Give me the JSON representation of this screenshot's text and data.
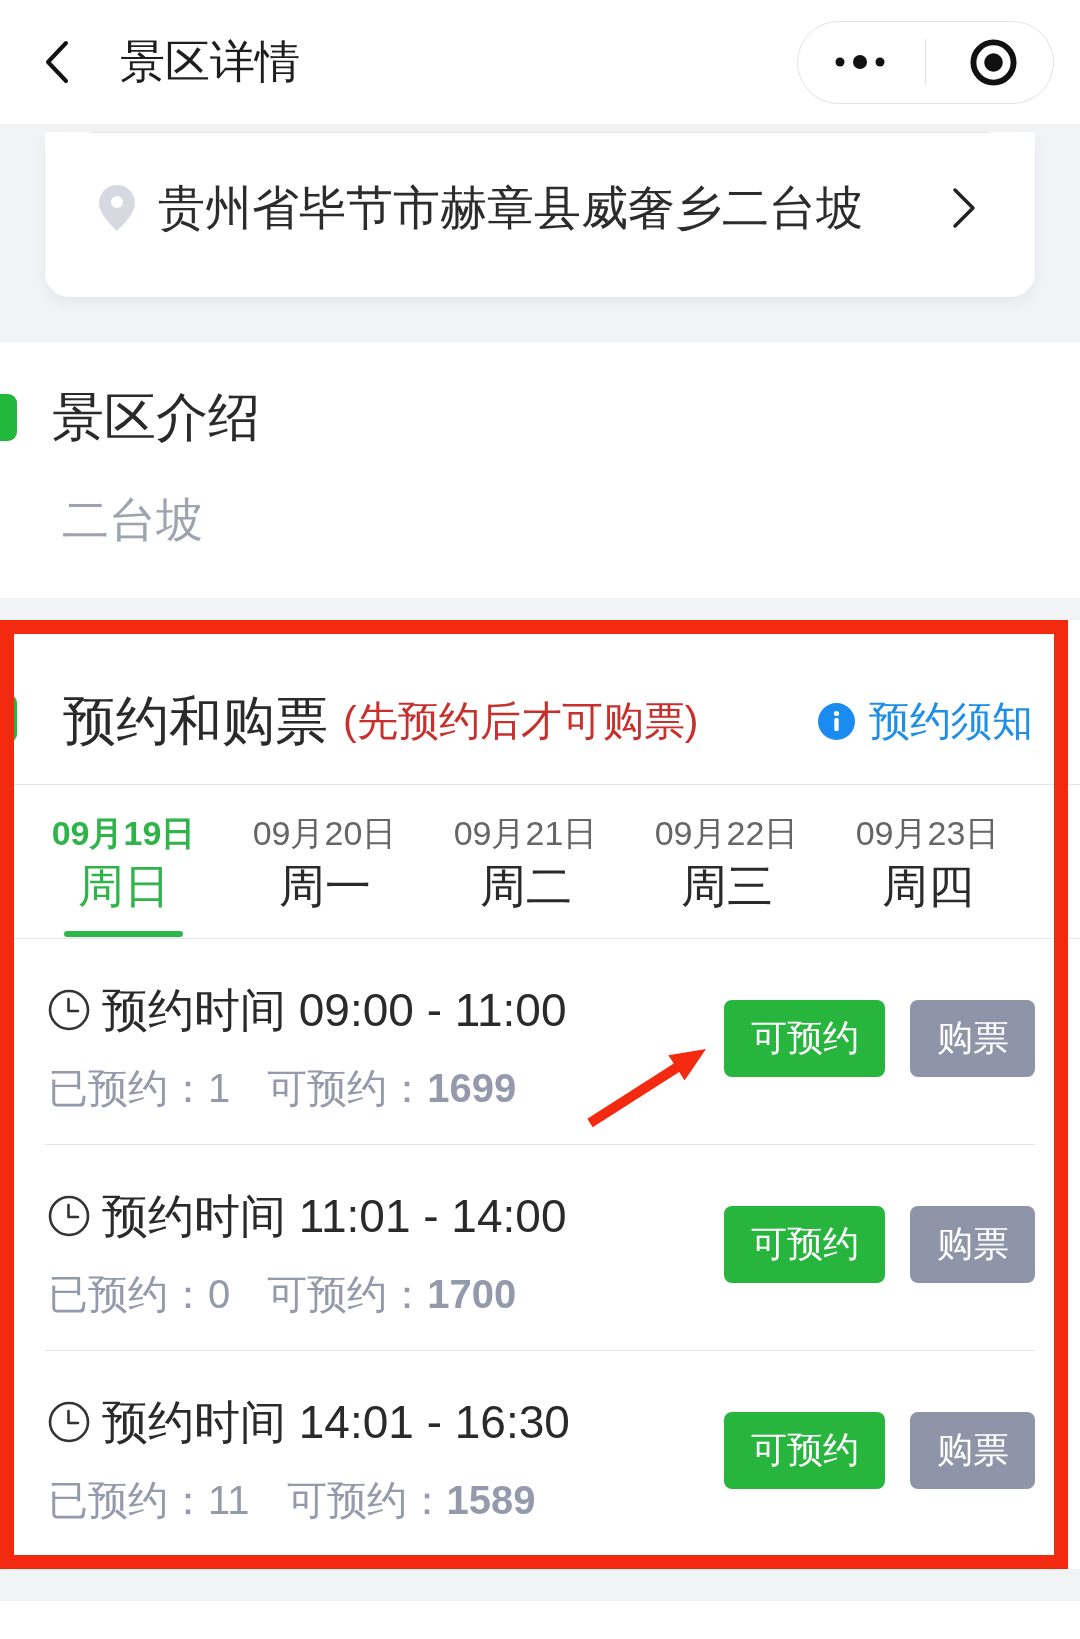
{
  "header": {
    "title": "景区详情"
  },
  "address": {
    "text": "贵州省毕节市赫章县威奢乡二台坡"
  },
  "intro": {
    "title": "景区介绍",
    "text": "二台坡"
  },
  "booking": {
    "title": "预约和购票",
    "note": "(先预约后才可购票)",
    "notice_link": "预约须知",
    "dates": [
      {
        "date": "09月19日",
        "weekday": "周日",
        "selected": true
      },
      {
        "date": "09月20日",
        "weekday": "周一",
        "selected": false
      },
      {
        "date": "09月21日",
        "weekday": "周二",
        "selected": false
      },
      {
        "date": "09月22日",
        "weekday": "周三",
        "selected": false
      },
      {
        "date": "09月23日",
        "weekday": "周四",
        "selected": false
      }
    ],
    "slots": [
      {
        "time": "预约时间 09:00 - 11:00",
        "booked": "已预约：1",
        "available": "可预约：**1699**",
        "reserve": {
          "label": "可预约"
        },
        "buy": {
          "label": "购票",
          "disabled": true
        }
      },
      {
        "time": "预约时间 11:01 - 14:00",
        "booked": "已预约：0",
        "available": "可预约：**1700**",
        "reserve": {
          "label": "可预约"
        },
        "buy": {
          "label": "购票",
          "disabled": true
        }
      },
      {
        "time": "预约时间 14:01 - 16:30",
        "booked": "已预约：11",
        "available": "可预约：**1589**",
        "reserve": {
          "label": "可预约"
        },
        "buy": {
          "label": "购票",
          "disabled": true
        }
      }
    ],
    "annotations": {
      "frame": true,
      "arrow": true
    }
  }
}
